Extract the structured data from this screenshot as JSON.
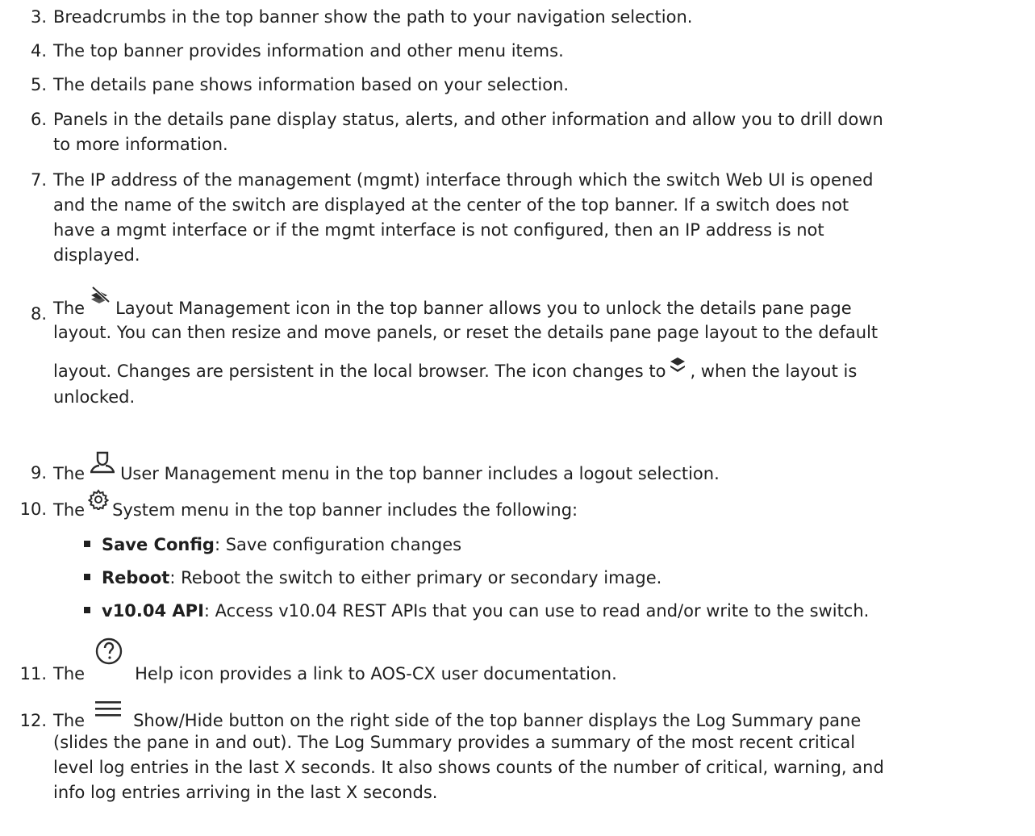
{
  "items": [
    {
      "num": "3.",
      "lines": [
        "Breadcrumbs in the top banner show the path to your navigation selection."
      ]
    },
    {
      "num": "4.",
      "lines": [
        "The top banner provides information and other menu items."
      ]
    },
    {
      "num": "5.",
      "lines": [
        "The details pane shows information based on your selection."
      ]
    },
    {
      "num": "6.",
      "lines": [
        "Panels in the details pane display status, alerts, and other information and allow you to drill down",
        "to more information."
      ]
    },
    {
      "num": "7.",
      "lines": [
        "The IP address of the management (mgmt) interface through which the switch Web UI is opened",
        "and the name of the switch are displayed at the center of the top banner. If a switch does not",
        "have a mgmt interface or if the mgmt interface is not configured, then an IP address is not",
        "displayed."
      ]
    },
    {
      "num": "8.",
      "pre": "The",
      "post": "Layout Management icon in the top banner allows you to unlock the details pane page",
      "lines": [
        "layout. You can then resize and move panels, or reset the details pane page layout to the default"
      ],
      "line3_pre": "layout. Changes are persistent in the local browser. The icon changes to",
      "line3_post": ", when the layout is",
      "line4": "unlocked."
    },
    {
      "num": "9.",
      "pre": "The",
      "post": "User Management menu in the top banner includes a logout selection."
    },
    {
      "num": "10.",
      "pre": "The",
      "post": "System menu in the top banner includes the following:"
    },
    {
      "num": "11.",
      "pre": "The",
      "post": "Help icon provides a link to AOS-CX user documentation."
    },
    {
      "num": "12.",
      "pre": "The",
      "post": "Show/Hide button on the right side of the top banner displays the Log Summary pane",
      "lines": [
        "(slides the pane in and out). The Log Summary provides a summary of the most recent critical",
        "level log entries in the last X seconds. It also shows counts of the number of critical, warning, and",
        "info log entries arriving in the last X seconds."
      ]
    }
  ],
  "system_menu": [
    {
      "label": "Save Config",
      "desc": ": Save configuration changes"
    },
    {
      "label": "Reboot",
      "desc": ": Reboot the switch to either primary or secondary image."
    },
    {
      "label": "v10.04 API",
      "desc": ": Access v10.04 REST APIs that you can use to read and/or write to the switch."
    }
  ],
  "icons": {
    "layout_lock": "layout-management-icon",
    "layout_unlocked": "layers-icon",
    "user": "user-icon",
    "system": "gear-icon",
    "help": "help-icon",
    "menu": "hamburger-menu-icon"
  }
}
